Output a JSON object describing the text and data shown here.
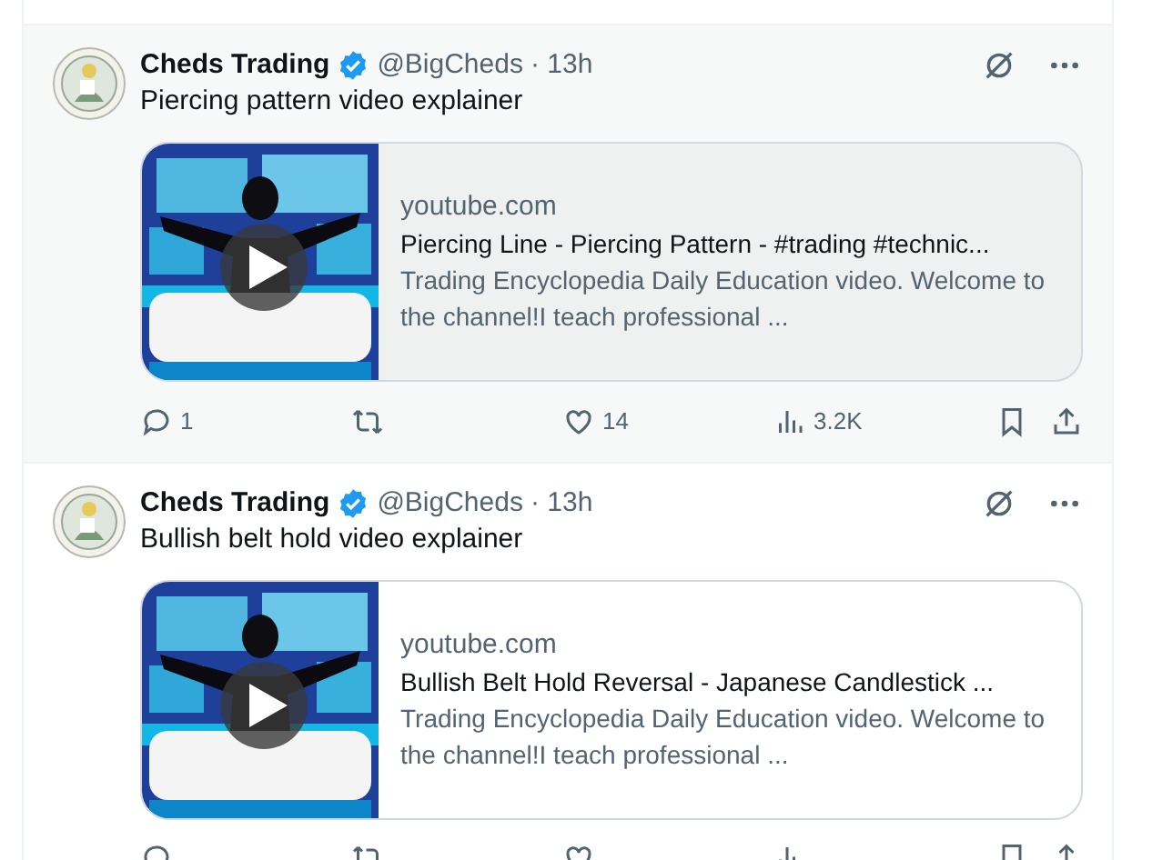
{
  "tweets": [
    {
      "highlighted": true,
      "author": "Cheds Trading",
      "handle": "@BigCheds",
      "time": "· 13h",
      "text": "Piercing pattern video explainer",
      "card": {
        "domain": "youtube.com",
        "title": "Piercing Line - Piercing Pattern - #trading #technic...",
        "description": "Trading Encyclopedia Daily Education video. Welcome to the channel!I teach professional ..."
      },
      "replies": "1",
      "likes": "14",
      "views": "3.2K"
    },
    {
      "highlighted": false,
      "author": "Cheds Trading",
      "handle": "@BigCheds",
      "time": "· 13h",
      "text": "Bullish belt hold video explainer",
      "card": {
        "domain": "youtube.com",
        "title": "Bullish Belt Hold Reversal - Japanese Candlestick ...",
        "description": "Trading Encyclopedia Daily Education video. Welcome to the channel!I teach professional ..."
      }
    }
  ]
}
